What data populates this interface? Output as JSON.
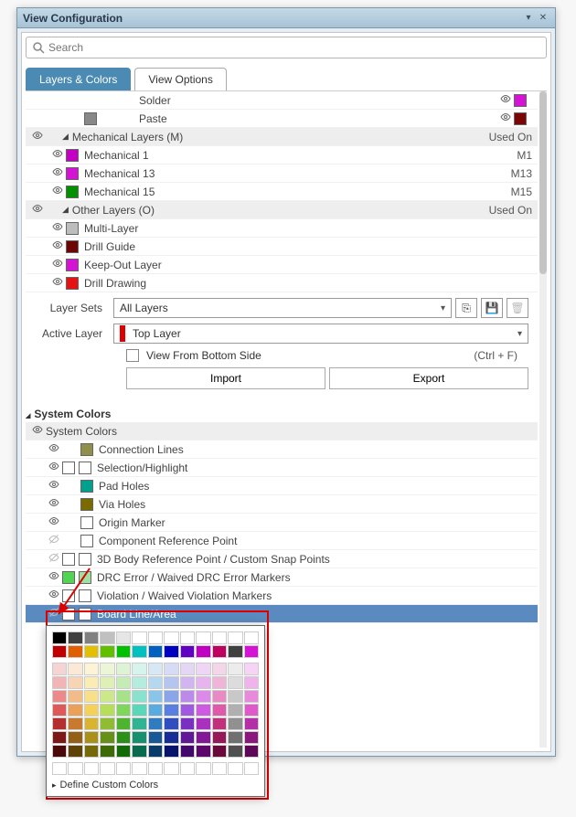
{
  "panel": {
    "title": "View Configuration"
  },
  "search": {
    "placeholder": "Search"
  },
  "tabs": {
    "layersColors": "Layers & Colors",
    "viewOptions": "View Options"
  },
  "topRows": [
    {
      "name": "Solder",
      "color": "#d413d4",
      "vis2": true
    },
    {
      "name": "Paste",
      "color": "#7a0606",
      "swatch2": "#888",
      "vis2": true
    }
  ],
  "groups": [
    {
      "label": "Mechanical Layers (M)",
      "right": "Used On",
      "items": [
        {
          "name": "Mechanical 1",
          "color": "#c300c3",
          "tag": "M1"
        },
        {
          "name": "Mechanical 13",
          "color": "#d413d4",
          "tag": "M13"
        },
        {
          "name": "Mechanical 15",
          "color": "#009000",
          "tag": "M15"
        }
      ]
    },
    {
      "label": "Other Layers (O)",
      "right": "Used On",
      "items": [
        {
          "name": "Multi-Layer",
          "color": "#bdbdbd"
        },
        {
          "name": "Drill Guide",
          "color": "#6e0505"
        },
        {
          "name": "Keep-Out Layer",
          "color": "#d413d4"
        },
        {
          "name": "Drill Drawing",
          "color": "#e41212"
        }
      ]
    }
  ],
  "layerSets": {
    "label": "Layer Sets",
    "value": "All Layers"
  },
  "activeLayer": {
    "label": "Active Layer",
    "value": "Top Layer"
  },
  "viewFromBottom": {
    "label": "View From Bottom Side",
    "hint": "(Ctrl + F)"
  },
  "buttons": {
    "import": "Import",
    "export": "Export"
  },
  "systemColors": {
    "sectionTitle": "System Colors",
    "header": "System Colors",
    "items": [
      {
        "name": "Connection Lines",
        "color": "#8f8f4b",
        "single": true
      },
      {
        "name": "Selection/Highlight",
        "c1": "#ffffff",
        "c2": "#ffffff"
      },
      {
        "name": "Pad Holes",
        "color": "#00a08e",
        "single": true
      },
      {
        "name": "Via Holes",
        "color": "#7a6a00",
        "single": true
      },
      {
        "name": "Origin Marker",
        "color": "#ffffff",
        "single": true
      },
      {
        "name": "Component Reference Point",
        "color": "#ffffff",
        "single": true,
        "muted": true
      },
      {
        "name": "3D Body Reference Point / Custom Snap Points",
        "c1": "#ffffff",
        "c2": "#ffffff",
        "muted": true
      },
      {
        "name": "DRC Error / Waived DRC Error Markers",
        "c1": "#54d454",
        "c2": "#9fe09f"
      },
      {
        "name": "Violation / Waived Violation Markers",
        "c1": "#ffffff",
        "c2": "#ffffff"
      },
      {
        "name": "Board Line/Area",
        "c1": "#ffffff",
        "c2": "#ffffff",
        "selected": true,
        "muted": true
      }
    ]
  },
  "colorPopup": {
    "define": "Define Custom Colors",
    "mainRows": [
      [
        "#000000",
        "#404040",
        "#808080",
        "#c0c0c0",
        "#e6e6e6",
        "#ffffff",
        "#ffffff",
        "#ffffff",
        "#ffffff",
        "#ffffff",
        "#ffffff",
        "#ffffff",
        "#ffffff"
      ],
      [
        "#c00000",
        "#e06000",
        "#e0c000",
        "#60c000",
        "#00c000",
        "#00c0c0",
        "#0060c0",
        "#0000c0",
        "#6000c0",
        "#c000c0",
        "#c00060",
        "#404040",
        "#d413d4"
      ]
    ],
    "shadeRows": [
      [
        "#f7d4d4",
        "#fbe8d6",
        "#fdf4d6",
        "#ecf5d6",
        "#dcf3d6",
        "#d6f3ec",
        "#d6e8f5",
        "#d6dcf5",
        "#e4d6f5",
        "#f0d6f5",
        "#f5d6e8",
        "#ececec",
        "#f7d4f5"
      ],
      [
        "#f2b4b4",
        "#f7d4b4",
        "#fbecb4",
        "#def0b4",
        "#c5ecb4",
        "#b4ece0",
        "#b4d8f0",
        "#b4c5f0",
        "#d2b4f0",
        "#e7b4f0",
        "#f0b4d8",
        "#dcdcdc",
        "#f0b4ec"
      ],
      [
        "#ea8a8a",
        "#f2bc8a",
        "#f8e08a",
        "#cce88a",
        "#a6e28a",
        "#8ae2ce",
        "#8ac4e8",
        "#8aa6e8",
        "#bc8ae8",
        "#db8ae8",
        "#e88ac4",
        "#c8c8c8",
        "#e88adc"
      ],
      [
        "#de5a5a",
        "#eba05a",
        "#f4d25a",
        "#b7de5a",
        "#7fd65a",
        "#5ad6b8",
        "#5aace0",
        "#5a7fe0",
        "#a05ae0",
        "#cd5ae0",
        "#e05aac",
        "#b0b0b0",
        "#de5ac8"
      ],
      [
        "#b43030",
        "#c87a30",
        "#d8b430",
        "#8fbc30",
        "#4eb430",
        "#30b494",
        "#307cc0",
        "#304ec0",
        "#7a30c0",
        "#aa30c0",
        "#c0307c",
        "#909090",
        "#b430a6"
      ],
      [
        "#7c1818",
        "#946018",
        "#aa9018",
        "#679018",
        "#2c9018",
        "#189070",
        "#185896",
        "#182c96",
        "#601896",
        "#821896",
        "#961858",
        "#707070",
        "#8a187c"
      ],
      [
        "#4a0808",
        "#5e4208",
        "#766a08",
        "#3f6a08",
        "#146a08",
        "#086a4e",
        "#083a6a",
        "#08146a",
        "#42086a",
        "#5c086a",
        "#6a083a",
        "#505050",
        "#5c0856"
      ]
    ],
    "emptyRow": [
      "#ffffff",
      "#ffffff",
      "#ffffff",
      "#ffffff",
      "#ffffff",
      "#ffffff",
      "#ffffff",
      "#ffffff",
      "#ffffff",
      "#ffffff",
      "#ffffff",
      "#ffffff",
      "#ffffff"
    ]
  }
}
